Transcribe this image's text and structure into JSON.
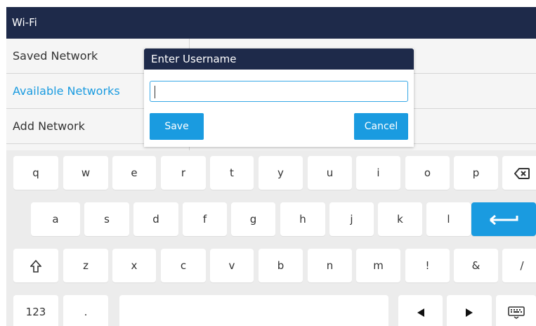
{
  "app": {
    "title": "Wi-Fi"
  },
  "menu": {
    "items": [
      {
        "label": "Saved Network",
        "active": false
      },
      {
        "label": "Available Networks",
        "active": true
      },
      {
        "label": "Add Network",
        "active": false
      }
    ]
  },
  "dialog": {
    "title": "Enter Username",
    "input_value": "",
    "save_label": "Save",
    "cancel_label": "Cancel"
  },
  "keyboard": {
    "row1": [
      "q",
      "w",
      "e",
      "r",
      "t",
      "y",
      "u",
      "i",
      "o",
      "p"
    ],
    "row2": [
      "a",
      "s",
      "d",
      "f",
      "g",
      "h",
      "j",
      "k",
      "l"
    ],
    "row3": [
      "z",
      "x",
      "c",
      "v",
      "b",
      "n",
      "m",
      "!",
      "&",
      "/"
    ],
    "numeric_label": "123",
    "dot_label": ".",
    "icons": {
      "backspace": "backspace-icon",
      "enter": "enter-icon",
      "shift": "shift-icon",
      "left": "arrow-left-icon",
      "right": "arrow-right-icon",
      "hide_keyboard": "keyboard-icon"
    },
    "colors": {
      "accent": "#1a9be0",
      "header": "#1e2a4a"
    }
  }
}
